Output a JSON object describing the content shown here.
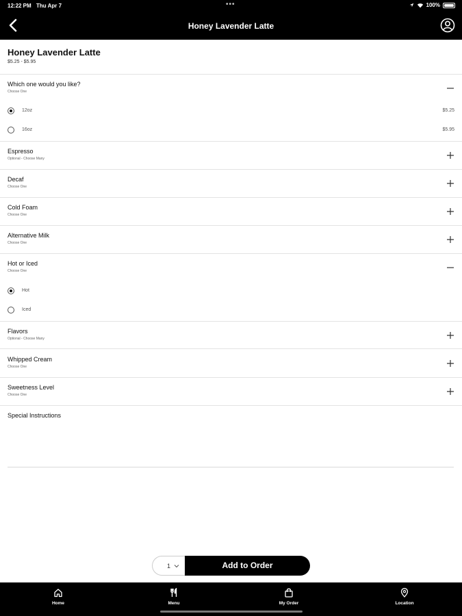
{
  "status_bar": {
    "time": "12:22 PM",
    "date": "Thu Apr 7",
    "battery": "100%"
  },
  "header": {
    "title": "Honey Lavender Latte",
    "back_icon": "chevron-left-icon",
    "profile_icon": "user-circle-icon"
  },
  "product": {
    "name": "Honey Lavender Latte",
    "price_range": "$5.25 - $5.95"
  },
  "size_section": {
    "title": "Which one would you like?",
    "subtitle": "Choose One",
    "expanded": true,
    "options": [
      {
        "label": "12oz",
        "price": "$5.25",
        "selected": true
      },
      {
        "label": "16oz",
        "price": "$5.95",
        "selected": false
      }
    ]
  },
  "sections": [
    {
      "title": "Espresso",
      "subtitle": "Optional - Choose Many"
    },
    {
      "title": "Decaf",
      "subtitle": "Choose One"
    },
    {
      "title": "Cold Foam",
      "subtitle": "Choose One"
    },
    {
      "title": "Alternative Milk",
      "subtitle": "Choose One"
    }
  ],
  "hot_iced_section": {
    "title": "Hot or Iced",
    "subtitle": "Choose One",
    "expanded": true,
    "options": [
      {
        "label": "Hot",
        "selected": true
      },
      {
        "label": "Iced",
        "selected": false
      }
    ]
  },
  "sections_after": [
    {
      "title": "Flavors",
      "subtitle": "Optional - Choose Many"
    },
    {
      "title": "Whipped Cream",
      "subtitle": "Choose One"
    },
    {
      "title": "Sweetness Level",
      "subtitle": "Choose One"
    }
  ],
  "special_instructions": {
    "label": "Special Instructions",
    "value": ""
  },
  "order_bar": {
    "quantity": "1",
    "add_label": "Add to Order"
  },
  "bottom_nav": [
    {
      "label": "Home",
      "icon": "home-icon"
    },
    {
      "label": "Menu",
      "icon": "utensils-icon"
    },
    {
      "label": "My Order",
      "icon": "shopping-bag-icon"
    },
    {
      "label": "Location",
      "icon": "map-pin-icon"
    }
  ],
  "colors": {
    "header_bg": "#000000",
    "accent": "#000000",
    "text": "#111111"
  }
}
